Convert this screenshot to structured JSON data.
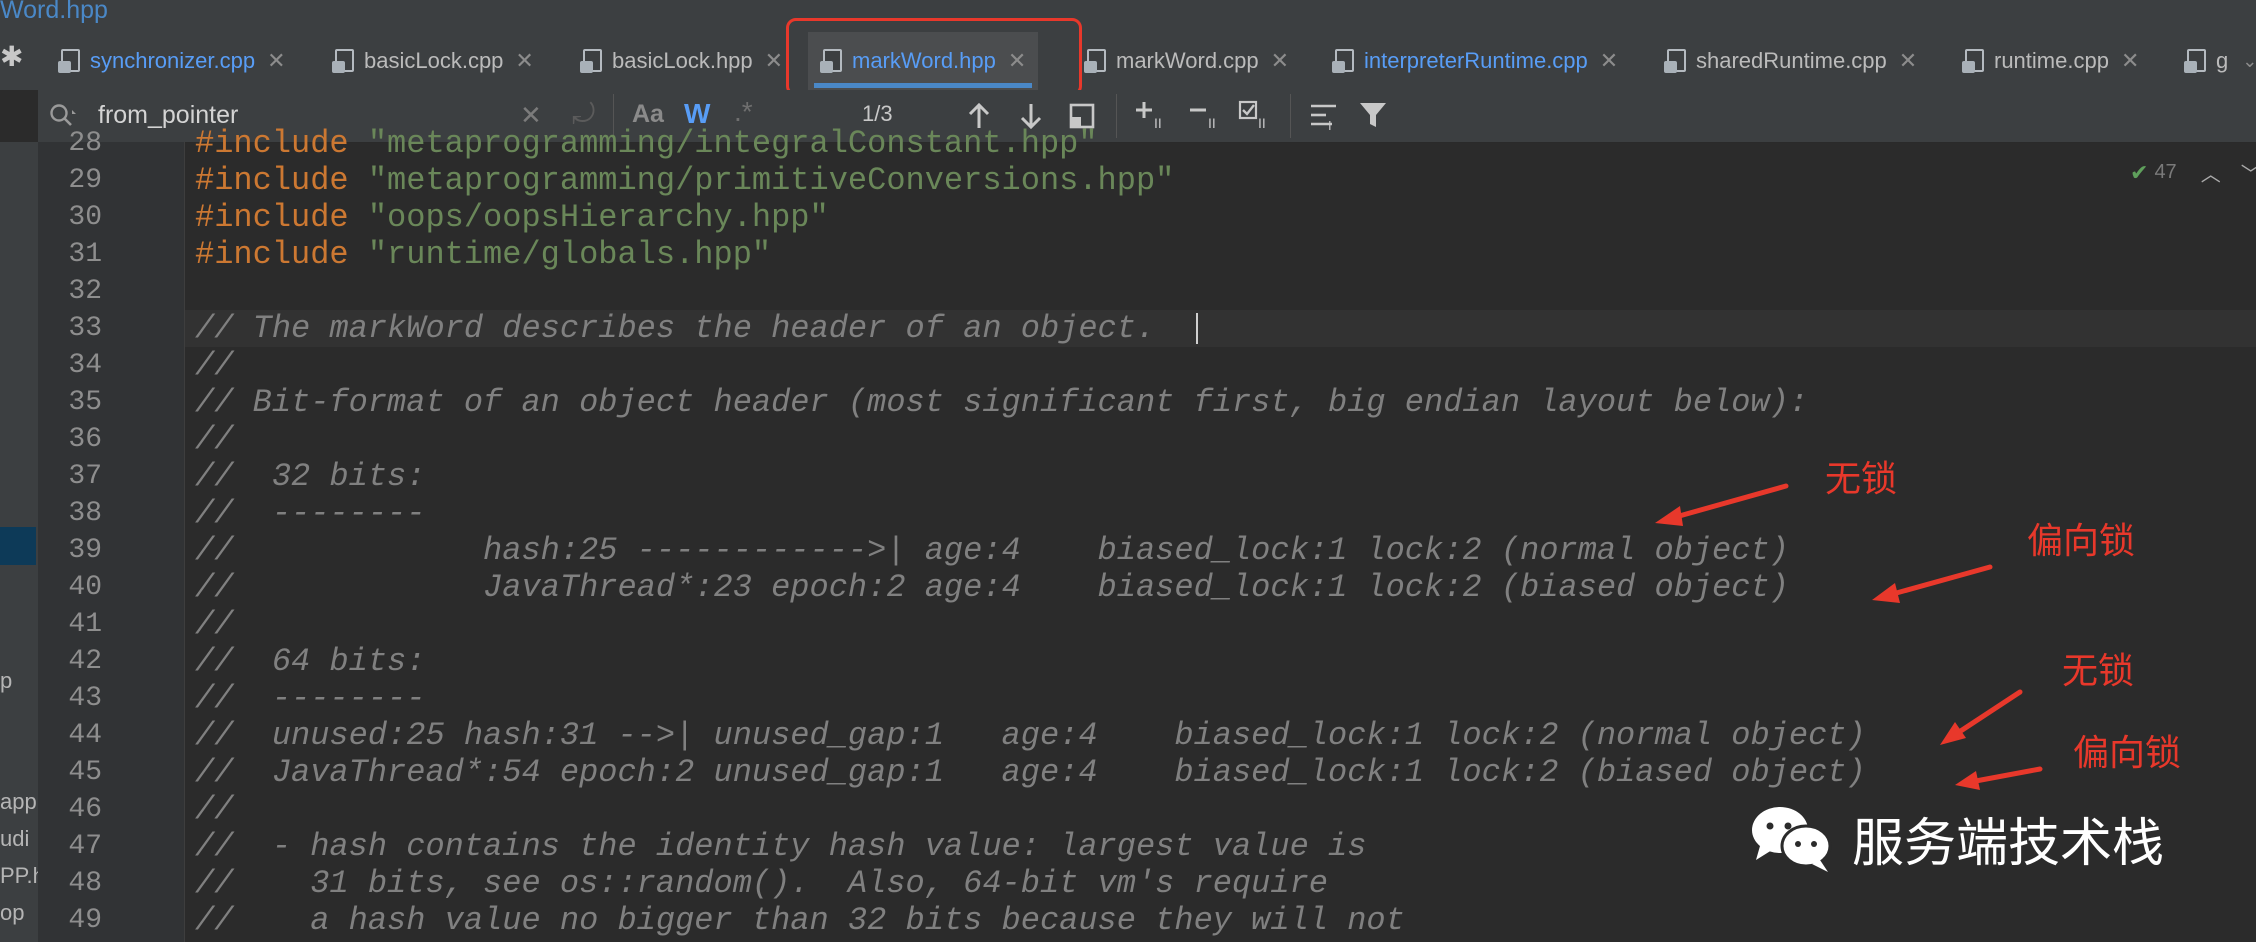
{
  "window": {
    "title": "Word.hpp"
  },
  "tabs": [
    {
      "label": "synchronizer.cpp",
      "active": false,
      "color": "blue"
    },
    {
      "label": "basicLock.cpp",
      "active": false,
      "color": "default"
    },
    {
      "label": "basicLock.hpp",
      "active": false,
      "color": "default"
    },
    {
      "label": "markWord.hpp",
      "active": true,
      "color": "blue"
    },
    {
      "label": "markWord.cpp",
      "active": false,
      "color": "default"
    },
    {
      "label": "interpreterRuntime.cpp",
      "active": false,
      "color": "blue"
    },
    {
      "label": "sharedRuntime.cpp",
      "active": false,
      "color": "default"
    },
    {
      "label": "runtime.cpp",
      "active": false,
      "color": "default"
    },
    {
      "label": "g",
      "active": false,
      "color": "default"
    }
  ],
  "search": {
    "query": "from_pointer",
    "match_case": "Aa",
    "whole_words": "W",
    "regex": ".*",
    "match_count": "1/3"
  },
  "left_panel_fragments": [
    "p",
    "app",
    "udi",
    "PP.h",
    "op"
  ],
  "editor": {
    "inspection_count": "47",
    "line_numbers": [
      "28",
      "29",
      "30",
      "31",
      "32",
      "33",
      "34",
      "35",
      "36",
      "37",
      "38",
      "39",
      "40",
      "41",
      "42",
      "43",
      "44",
      "45",
      "46",
      "47",
      "48",
      "49"
    ],
    "lines": {
      "l28": {
        "kw": "#include",
        "str": "\"metaprogramming/integralConstant.hpp\""
      },
      "l29": {
        "kw": "#include",
        "str": "\"metaprogramming/primitiveConversions.hpp\""
      },
      "l30": {
        "kw": "#include",
        "str": "\"oops/oopsHierarchy.hpp\""
      },
      "l31": {
        "kw": "#include",
        "str": "\"runtime/globals.hpp\""
      },
      "l32": "",
      "l33": "// The markWord describes the header of an object.",
      "l34": "//",
      "l35": "// Bit-format of an object header (most significant first, big endian layout below):",
      "l36": "//",
      "l37": "//  32 bits:",
      "l38": "//  --------",
      "l39": "//             hash:25 ------------>| age:4    biased_lock:1 lock:2 (normal object)",
      "l40": "//             JavaThread*:23 epoch:2 age:4    biased_lock:1 lock:2 (biased object)",
      "l41": "//",
      "l42": "//  64 bits:",
      "l43": "//  --------",
      "l44": "//  unused:25 hash:31 -->| unused_gap:1   age:4    biased_lock:1 lock:2 (normal object)",
      "l45": "//  JavaThread*:54 epoch:2 unused_gap:1   age:4    biased_lock:1 lock:2 (biased object)",
      "l46": "//",
      "l47": "//  - hash contains the identity hash value: largest value is",
      "l48": "//    31 bits, see os::random().  Also, 64-bit vm's require",
      "l49": "//    a hash value no bigger than 32 bits because they will not"
    }
  },
  "annotations": {
    "a1": "无锁",
    "a2": "偏向锁",
    "a3": "无锁",
    "a4": "偏向锁"
  },
  "watermark": {
    "text": "服务端技术栈"
  },
  "colors": {
    "highlight_box": "#e8382b",
    "arrows": "#e8382b",
    "tab_underline": "#4a88c7"
  }
}
